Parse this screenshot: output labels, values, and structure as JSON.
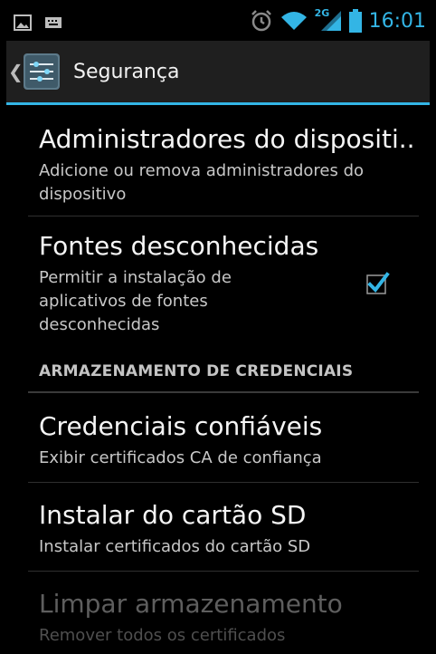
{
  "status_bar": {
    "time": "16:01",
    "network_label": "2G",
    "left_icons": [
      "image-notification-icon",
      "keyboard-notification-icon"
    ],
    "right_icons": [
      "alarm-icon",
      "wifi-icon",
      "signal-icon",
      "battery-icon"
    ],
    "accent_color": "#33b5e5"
  },
  "action_bar": {
    "title": "Segurança",
    "up_icon": "chevron-left-icon",
    "app_icon": "settings-sliders-icon"
  },
  "items": [
    {
      "title": "Administradores do dispositi..",
      "summary": "Adicione ou remova administradores do dispositivo"
    },
    {
      "title": "Fontes desconhecidas",
      "summary": "Permitir a instalação de aplicativos de fontes desconhecidas",
      "checked": true
    }
  ],
  "section_header": "ARMAZENAMENTO DE CREDENCIAIS",
  "credential_items": [
    {
      "title": "Credenciais confiáveis",
      "summary": "Exibir certificados CA de confiança"
    },
    {
      "title": "Instalar do cartão SD",
      "summary": "Instalar certificados do cartão SD"
    },
    {
      "title": "Limpar armazenamento",
      "summary": "Remover todos os certificados",
      "disabled": true
    }
  ]
}
